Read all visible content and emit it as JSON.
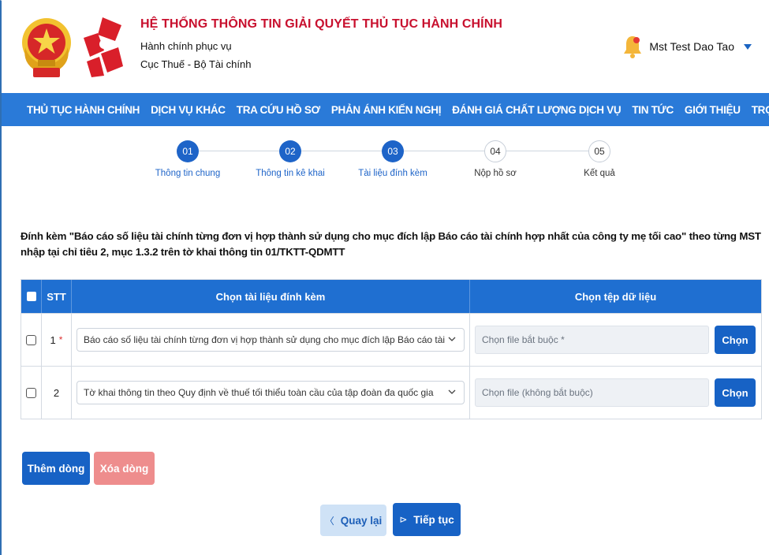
{
  "header": {
    "title": "HỆ THỐNG THÔNG TIN GIẢI QUYẾT THỦ TỤC HÀNH CHÍNH",
    "subtitle1": "Hành chính phục vụ",
    "subtitle2": "Cục Thuế - Bộ Tài chính",
    "user_name": "Mst Test Dao Tao"
  },
  "nav": {
    "items": [
      "THỦ TỤC HÀNH CHÍNH",
      "DỊCH VỤ KHÁC",
      "TRA CỨU HỒ SƠ",
      "PHẢN ÁNH KIẾN NGHỊ",
      "ĐÁNH GIÁ CHẤT LƯỢNG DỊCH VỤ",
      "TIN TỨC",
      "GIỚI THIỆU",
      "TRỢ GIÚP"
    ]
  },
  "steps": [
    {
      "num": "01",
      "label": "Thông tin chung",
      "active": true
    },
    {
      "num": "02",
      "label": "Thông tin kê khai",
      "active": true
    },
    {
      "num": "03",
      "label": "Tài liệu đính kèm",
      "active": true
    },
    {
      "num": "04",
      "label": "Nộp hồ sơ",
      "active": false
    },
    {
      "num": "05",
      "label": "Kết quả",
      "active": false
    }
  ],
  "description": "Đính kèm \"Báo cáo số liệu tài chính từng đơn vị hợp thành sử dụng cho mục đích lập Báo cáo tài chính hợp nhất của công ty mẹ tối cao\" theo từng MST nhập tại chỉ tiêu 2, mục 1.3.2 trên tờ khai thông tin 01/TKTT-QDMTT",
  "table": {
    "headers": {
      "stt": "STT",
      "doc": "Chọn tài liệu đính kèm",
      "file": "Chọn tệp dữ liệu"
    },
    "rows": [
      {
        "stt": "1",
        "required_mark": "*",
        "doc": "Báo cáo số liệu tài chính từng đơn vị hợp thành sử dụng cho mục đích lập Báo cáo tài chính hợp nhất của công ty mẹ tối cao",
        "file_placeholder": "Chọn file bắt buộc *",
        "choose_label": "Chọn"
      },
      {
        "stt": "2",
        "required_mark": "",
        "doc": "Tờ khai thông tin theo Quy định về thuế tối thiểu toàn cầu của tập đoàn đa quốc gia",
        "file_placeholder": "Chọn file (không bắt buộc)",
        "choose_label": "Chọn"
      }
    ]
  },
  "buttons": {
    "add_row": "Thêm dòng",
    "delete_row": "Xóa dòng",
    "back": "Quay lại",
    "next": "Tiếp tục"
  },
  "colors": {
    "nav_bg": "#2a7ad8",
    "primary": "#1762c5",
    "title_red": "#c8102e",
    "delete_btn": "#ee8d8d",
    "back_btn": "#cfe2f6"
  }
}
